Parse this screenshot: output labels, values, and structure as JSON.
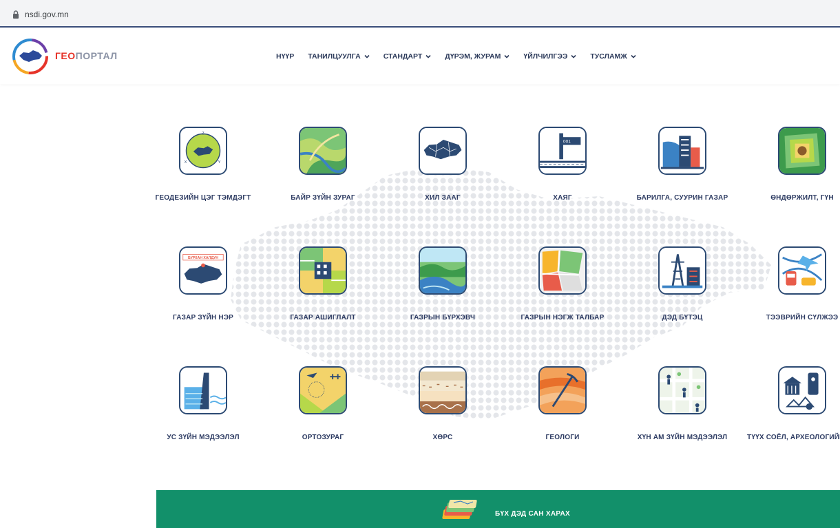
{
  "browser": {
    "url": "nsdi.gov.mn"
  },
  "header": {
    "brand_highlight": "ГЕО",
    "brand_rest": "ПОРТАЛ",
    "nav": [
      {
        "label": "НҮҮР",
        "dropdown": false
      },
      {
        "label": "ТАНИЛЦУУЛГА",
        "dropdown": true
      },
      {
        "label": "СТАНДАРТ",
        "dropdown": true
      },
      {
        "label": "ДҮРЭМ, ЖУРАМ",
        "dropdown": true
      },
      {
        "label": "ҮЙЛЧИЛГЭЭ",
        "dropdown": true
      },
      {
        "label": "ТУСЛАМЖ",
        "dropdown": true
      }
    ]
  },
  "tiles": [
    {
      "label": "ГЕОДЕЗИЙН ЦЭГ ТЭМДЭГТ",
      "icon": "geodetic-point-icon"
    },
    {
      "label": "БАЙР ЗҮЙН ЗУРАГ",
      "icon": "topographic-map-icon"
    },
    {
      "label": "ХИЛ ЗААГ",
      "icon": "boundary-icon"
    },
    {
      "label": "ХАЯГ",
      "icon": "address-icon"
    },
    {
      "label": "БАРИЛГА, СУУРИН ГАЗАР",
      "icon": "building-icon"
    },
    {
      "label": "ӨНДӨРЖИЛТ, ГҮН",
      "icon": "elevation-icon"
    },
    {
      "label": "ГАЗАР ЗҮЙН НЭР",
      "icon": "geographic-name-icon",
      "badge": "БУРХАН ХАЛДУН"
    },
    {
      "label": "ГАЗАР АШИГЛАЛТ",
      "icon": "land-use-icon"
    },
    {
      "label": "ГАЗРЫН БҮРХЭВЧ",
      "icon": "land-cover-icon"
    },
    {
      "label": "ГАЗРЫН НЭГЖ ТАЛБАР",
      "icon": "land-parcel-icon"
    },
    {
      "label": "ДЭД БҮТЭЦ",
      "icon": "infrastructure-icon"
    },
    {
      "label": "ТЭЭВРИЙН СҮЛЖЭЭ",
      "icon": "transport-icon"
    },
    {
      "label": "УС ЗҮЙН МЭДЭЭЛЭЛ",
      "icon": "hydrography-icon"
    },
    {
      "label": "ОРТОЗУРАГ",
      "icon": "orthoimagery-icon"
    },
    {
      "label": "ХӨРС",
      "icon": "soil-icon"
    },
    {
      "label": "ГЕОЛОГИ",
      "icon": "geology-icon"
    },
    {
      "label": "ХҮН АМ ЗҮЙН МЭДЭЭЛЭЛ",
      "icon": "demography-icon"
    },
    {
      "label": "ТҮҮХ СОЁЛ, АРХЕОЛОГИЙН ӨВ",
      "icon": "heritage-icon"
    }
  ],
  "footer": {
    "view_all_label": "БҮХ ДЭД САН ХАРАХ"
  },
  "colors": {
    "navy": "#2c4a73",
    "green_band": "#12906a",
    "brand_red": "#e63329"
  }
}
